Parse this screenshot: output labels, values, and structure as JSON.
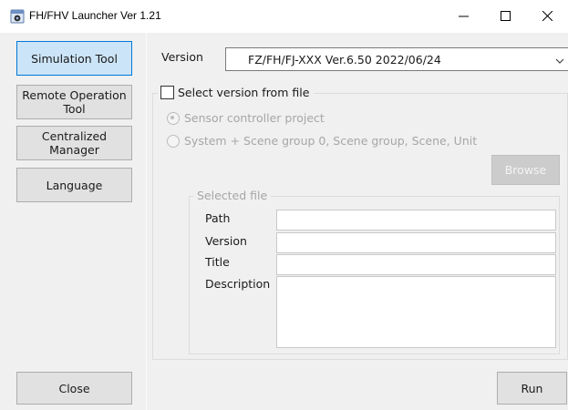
{
  "window": {
    "title": "FH/FHV Launcher Ver 1.21",
    "icon": "launcher-app-icon",
    "minimize_glyph": "—",
    "maximize_glyph": "☐",
    "close_glyph": "✕"
  },
  "sidebar": {
    "simulation_tool": "Simulation Tool",
    "remote_operation_tool": "Remote Operation Tool",
    "centralized_manager": "Centralized Manager",
    "language": "Language",
    "close": "Close"
  },
  "main": {
    "version_label": "Version",
    "version_value": "FZ/FH/FJ-XXX Ver.6.50 2022/06/24",
    "select_from_file_label": "Select version from file",
    "select_from_file_checked": false,
    "radio_sensor": "Sensor controller project",
    "radio_sensor_selected": true,
    "radio_system": "System + Scene group 0, Scene group, Scene, Unit",
    "browse": "Browse",
    "selected_file_legend": "Selected file",
    "path_label": "Path",
    "path_value": "",
    "version_field_label": "Version",
    "version_field_value": "",
    "title_label": "Title",
    "title_value": "",
    "description_label": "Description",
    "description_value": "",
    "run": "Run"
  },
  "colors": {
    "active_button_bg": "#cce4f7",
    "active_button_border": "#0078d7",
    "client_bg": "#f0f0f0",
    "disabled_text": "#a6a6a6"
  }
}
